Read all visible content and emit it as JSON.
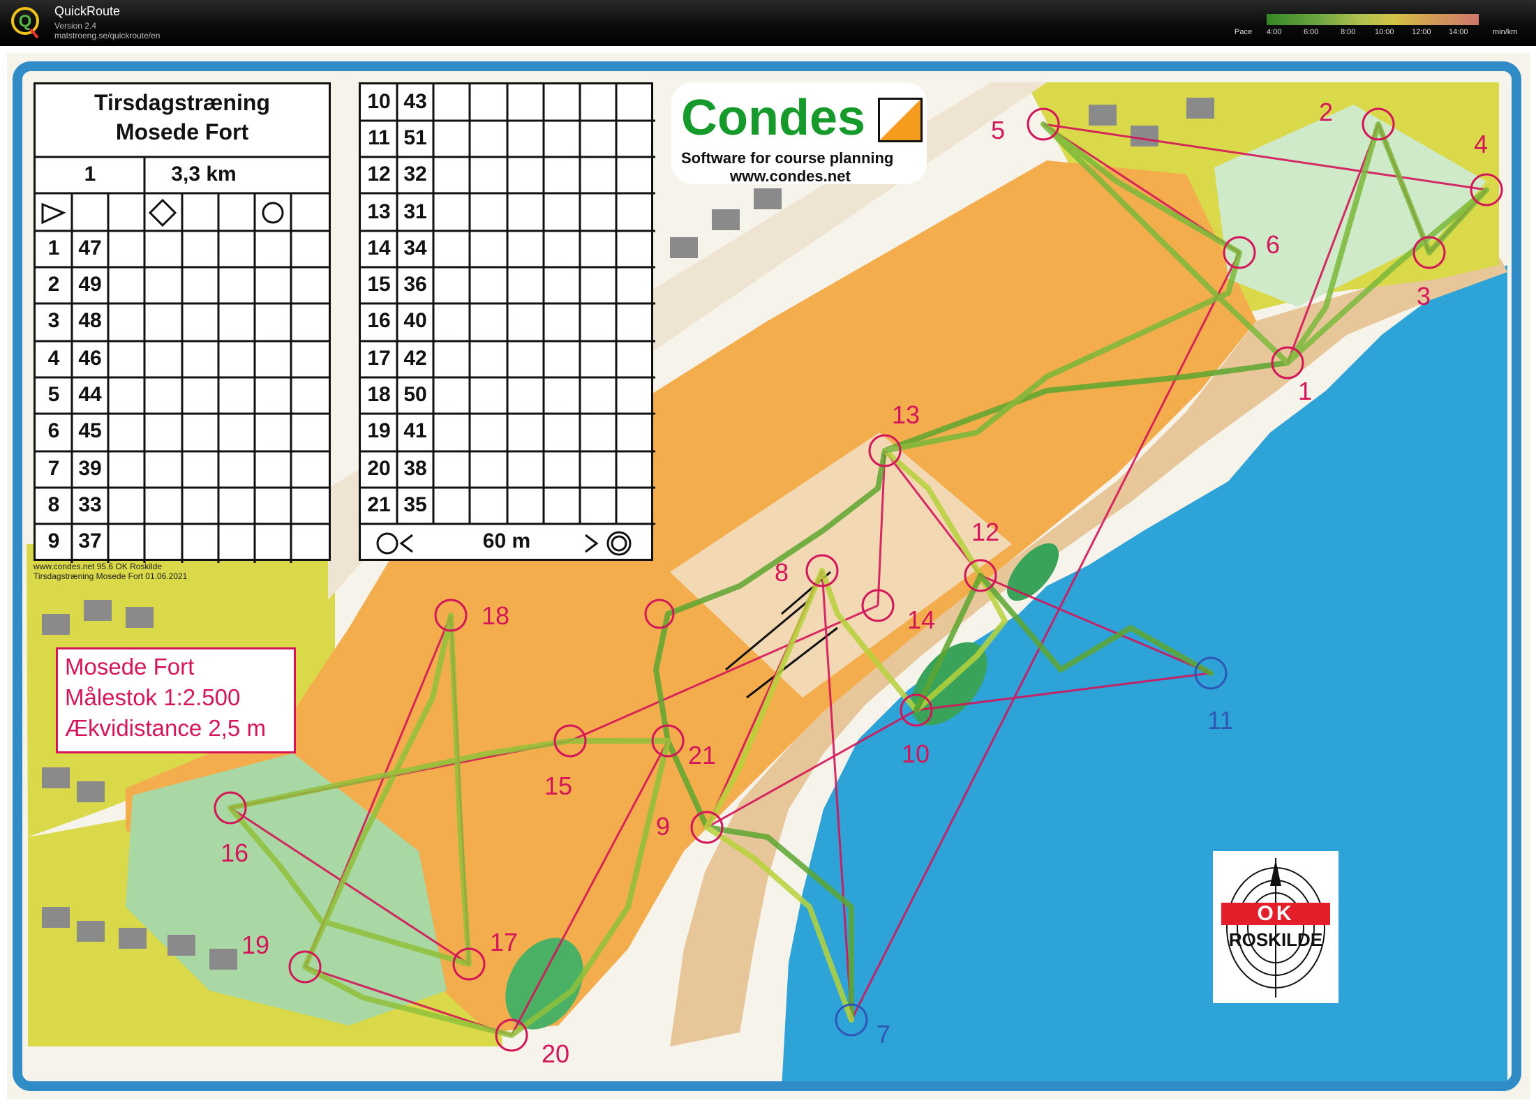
{
  "app": {
    "title": "QuickRoute",
    "version": "Version 2.4",
    "url": "matstroeng.se/quickroute/en"
  },
  "pace_legend": {
    "label": "Pace",
    "ticks": [
      "4:00",
      "6:00",
      "8:00",
      "10:00",
      "12:00",
      "14:00"
    ],
    "unit": "min/km",
    "colors": [
      "#3b9b2a",
      "#7ec048",
      "#cfe05a",
      "#f4e24e",
      "#f5b95c",
      "#f08a7a"
    ]
  },
  "control_description": {
    "title_line1": "Tirsdagstræning",
    "title_line2": "Mosede Fort",
    "course": "1",
    "length": "3,3 km",
    "rows_left": [
      {
        "num": "1",
        "code": "47"
      },
      {
        "num": "2",
        "code": "49"
      },
      {
        "num": "3",
        "code": "48"
      },
      {
        "num": "4",
        "code": "46"
      },
      {
        "num": "5",
        "code": "44"
      },
      {
        "num": "6",
        "code": "45"
      },
      {
        "num": "7",
        "code": "39"
      },
      {
        "num": "8",
        "code": "33"
      },
      {
        "num": "9",
        "code": "37"
      }
    ],
    "rows_right": [
      {
        "num": "10",
        "code": "43"
      },
      {
        "num": "11",
        "code": "51"
      },
      {
        "num": "12",
        "code": "32"
      },
      {
        "num": "13",
        "code": "31"
      },
      {
        "num": "14",
        "code": "34"
      },
      {
        "num": "15",
        "code": "36"
      },
      {
        "num": "16",
        "code": "40"
      },
      {
        "num": "17",
        "code": "42"
      },
      {
        "num": "18",
        "code": "50"
      },
      {
        "num": "19",
        "code": "41"
      },
      {
        "num": "20",
        "code": "38"
      },
      {
        "num": "21",
        "code": "35"
      }
    ],
    "finish_distance": "60 m"
  },
  "condes": {
    "name": "Condes",
    "tagline": "Software for course planning",
    "url": "www.condes.net"
  },
  "map_info": {
    "line1": "Mosede Fort",
    "line2": "Målestok 1:2.500",
    "line3": "Ækvidistance 2,5 m"
  },
  "footer": {
    "line1": "www.condes.net 95.6 OK Roskilde",
    "line2": "Tirsdagstræning Mosede Fort 01.06.2021"
  },
  "club": {
    "letters": "OK",
    "name": "ROSKILDE"
  },
  "controls": [
    "1",
    "2",
    "3",
    "4",
    "5",
    "6",
    "7",
    "8",
    "9",
    "10",
    "11",
    "12",
    "13",
    "14",
    "15",
    "16",
    "17",
    "18",
    "19",
    "20",
    "21"
  ]
}
